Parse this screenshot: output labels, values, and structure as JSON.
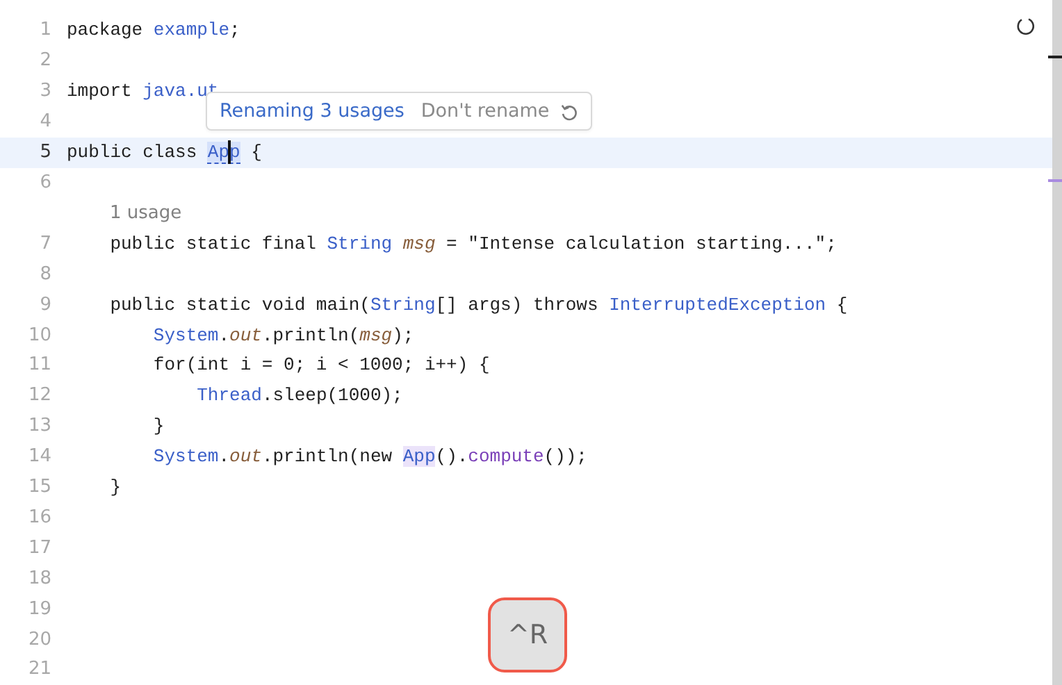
{
  "lines": [
    {
      "number": "1",
      "tokens": [
        {
          "kind": "text",
          "text": "package "
        },
        {
          "kind": "type",
          "text": "example"
        },
        {
          "kind": "text",
          "text": ";"
        }
      ]
    },
    {
      "number": "2"
    },
    {
      "number": "3",
      "tokens": [
        {
          "kind": "text",
          "text": "import "
        },
        {
          "kind": "type",
          "text": "java.ut"
        }
      ]
    },
    {
      "number": "4"
    },
    {
      "number": "5",
      "current": true,
      "tokens": [
        {
          "kind": "text",
          "text": "public class "
        },
        {
          "kind": "rename",
          "text": "App"
        },
        {
          "kind": "text",
          "text": " {"
        }
      ]
    },
    {
      "number": "6"
    },
    {
      "number": "7",
      "inlay": "1 usage",
      "tokens": [
        {
          "kind": "text",
          "text": "    public static final "
        },
        {
          "kind": "type",
          "text": "String "
        },
        {
          "kind": "field",
          "text": "msg"
        },
        {
          "kind": "text",
          "text": " = \"Intense calculation starting...\";"
        }
      ]
    },
    {
      "number": "8"
    },
    {
      "number": "9",
      "tokens": [
        {
          "kind": "text",
          "text": "    public static void main("
        },
        {
          "kind": "type",
          "text": "String"
        },
        {
          "kind": "text",
          "text": "[] args) throws "
        },
        {
          "kind": "type",
          "text": "InterruptedException"
        },
        {
          "kind": "text",
          "text": " {"
        }
      ]
    },
    {
      "number": "10",
      "tokens": [
        {
          "kind": "type",
          "text": "        System"
        },
        {
          "kind": "text",
          "text": "."
        },
        {
          "kind": "field",
          "text": "out"
        },
        {
          "kind": "text",
          "text": ".println("
        },
        {
          "kind": "field",
          "text": "msg"
        },
        {
          "kind": "text",
          "text": ");"
        }
      ]
    },
    {
      "number": "11",
      "tokens": [
        {
          "kind": "text",
          "text": "        for(int i = 0; i < 1000; i++) {"
        }
      ]
    },
    {
      "number": "12",
      "tokens": [
        {
          "kind": "type",
          "text": "            Thread"
        },
        {
          "kind": "text",
          "text": ".sleep(1000);"
        }
      ]
    },
    {
      "number": "13",
      "tokens": [
        {
          "kind": "text",
          "text": "        }"
        }
      ]
    },
    {
      "number": "14",
      "tokens": [
        {
          "kind": "type",
          "text": "        System"
        },
        {
          "kind": "text",
          "text": "."
        },
        {
          "kind": "field",
          "text": "out"
        },
        {
          "kind": "text",
          "text": ".println(new "
        },
        {
          "kind": "usage",
          "text": "App"
        },
        {
          "kind": "text",
          "text": "()."
        },
        {
          "kind": "method",
          "text": "compute"
        },
        {
          "kind": "text",
          "text": "());"
        }
      ]
    },
    {
      "number": "15",
      "tokens": [
        {
          "kind": "text",
          "text": "    }"
        }
      ]
    },
    {
      "number": "16"
    },
    {
      "number": "17"
    },
    {
      "number": "18"
    },
    {
      "number": "19"
    },
    {
      "number": "20"
    },
    {
      "number": "21"
    }
  ],
  "rename_popup": {
    "status": "Renaming 3 usages",
    "action": "Don't rename"
  },
  "shortcut_hint": {
    "keys": "^R"
  }
}
